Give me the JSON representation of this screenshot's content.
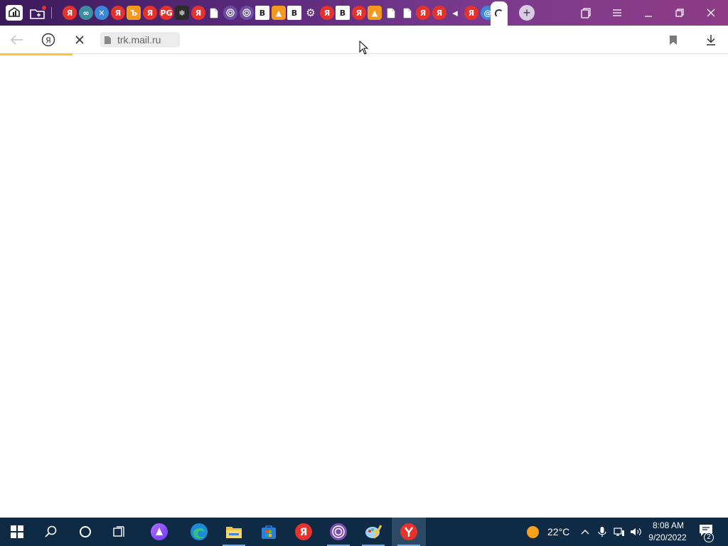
{
  "browser": {
    "address_bar": {
      "url": "trk.mail.ru"
    },
    "loading_progress_percent": 10,
    "pinned_tabs": [
      {
        "glyph": "Я",
        "kind": "red"
      },
      {
        "glyph": "∞",
        "kind": "teal"
      },
      {
        "glyph": "✕",
        "kind": "blue"
      },
      {
        "glyph": "Я",
        "kind": "red"
      },
      {
        "glyph": "Ъ",
        "kind": "orange"
      },
      {
        "glyph": "Я",
        "kind": "red"
      },
      {
        "glyph": "PG",
        "kind": "red"
      },
      {
        "glyph": "❄",
        "kind": "dark"
      },
      {
        "glyph": "Я",
        "kind": "red"
      },
      {
        "glyph": "",
        "kind": "doc"
      },
      {
        "glyph": "",
        "kind": "tor"
      },
      {
        "glyph": "",
        "kind": "tor"
      },
      {
        "glyph": "B",
        "kind": "white"
      },
      {
        "glyph": "▲",
        "kind": "orange"
      },
      {
        "glyph": "B",
        "kind": "white"
      },
      {
        "glyph": "⚙",
        "kind": "gear"
      },
      {
        "glyph": "Я",
        "kind": "red"
      },
      {
        "glyph": "B",
        "kind": "white"
      },
      {
        "glyph": "Я",
        "kind": "red"
      },
      {
        "glyph": "▲",
        "kind": "orange"
      },
      {
        "glyph": "",
        "kind": "doc"
      },
      {
        "glyph": "",
        "kind": "doc"
      },
      {
        "glyph": "Я",
        "kind": "red"
      },
      {
        "glyph": "Я",
        "kind": "red"
      },
      {
        "glyph": "◂",
        "kind": "gear"
      },
      {
        "glyph": "Я",
        "kind": "red"
      },
      {
        "glyph": "@",
        "kind": "blue"
      }
    ]
  },
  "taskbar": {
    "weather": {
      "temperature": "22°C"
    },
    "clock": {
      "time": "8:08 AM",
      "date": "9/20/2022"
    },
    "notifications": {
      "count": "2"
    },
    "apps": [
      {
        "name": "alice"
      },
      {
        "name": "edge"
      },
      {
        "name": "file-explorer"
      },
      {
        "name": "microsoft-store"
      },
      {
        "name": "yandex-red"
      },
      {
        "name": "tor-browser"
      },
      {
        "name": "paint-app"
      },
      {
        "name": "yandex-browser"
      }
    ]
  },
  "colors": {
    "progress": "#f8c629",
    "taskbar": "#0e2a45",
    "tabstrip_start": "#3c1a5a",
    "tabstrip_end": "#8e3c86"
  }
}
